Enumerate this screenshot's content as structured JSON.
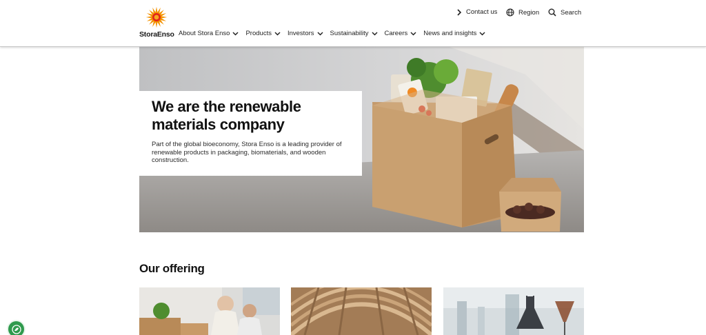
{
  "brand": {
    "name": "StoraEnso"
  },
  "utility": {
    "contact_label": "Contact us",
    "region_label": "Region",
    "search_label": "Search"
  },
  "nav": {
    "items": [
      {
        "label": "About Stora Enso"
      },
      {
        "label": "Products"
      },
      {
        "label": "Investors"
      },
      {
        "label": "Sustainability"
      },
      {
        "label": "Careers"
      },
      {
        "label": "News and insights"
      }
    ]
  },
  "hero": {
    "title": "We are the renewable materials company",
    "text": "Part of the global bioeconomy, Stora Enso is a leading provider of renewable products in packaging, biomaterials, and wooden construction."
  },
  "offering": {
    "title": "Our offering"
  },
  "icons": {
    "contact": "chevron-right-icon",
    "region": "globe-icon",
    "search": "search-icon",
    "dropdown": "chevron-down-icon",
    "badge": "leaf-icon"
  },
  "colors": {
    "logo_orange": "#f39200",
    "logo_red": "#e2231a",
    "badge_green": "#2f9a4d"
  }
}
